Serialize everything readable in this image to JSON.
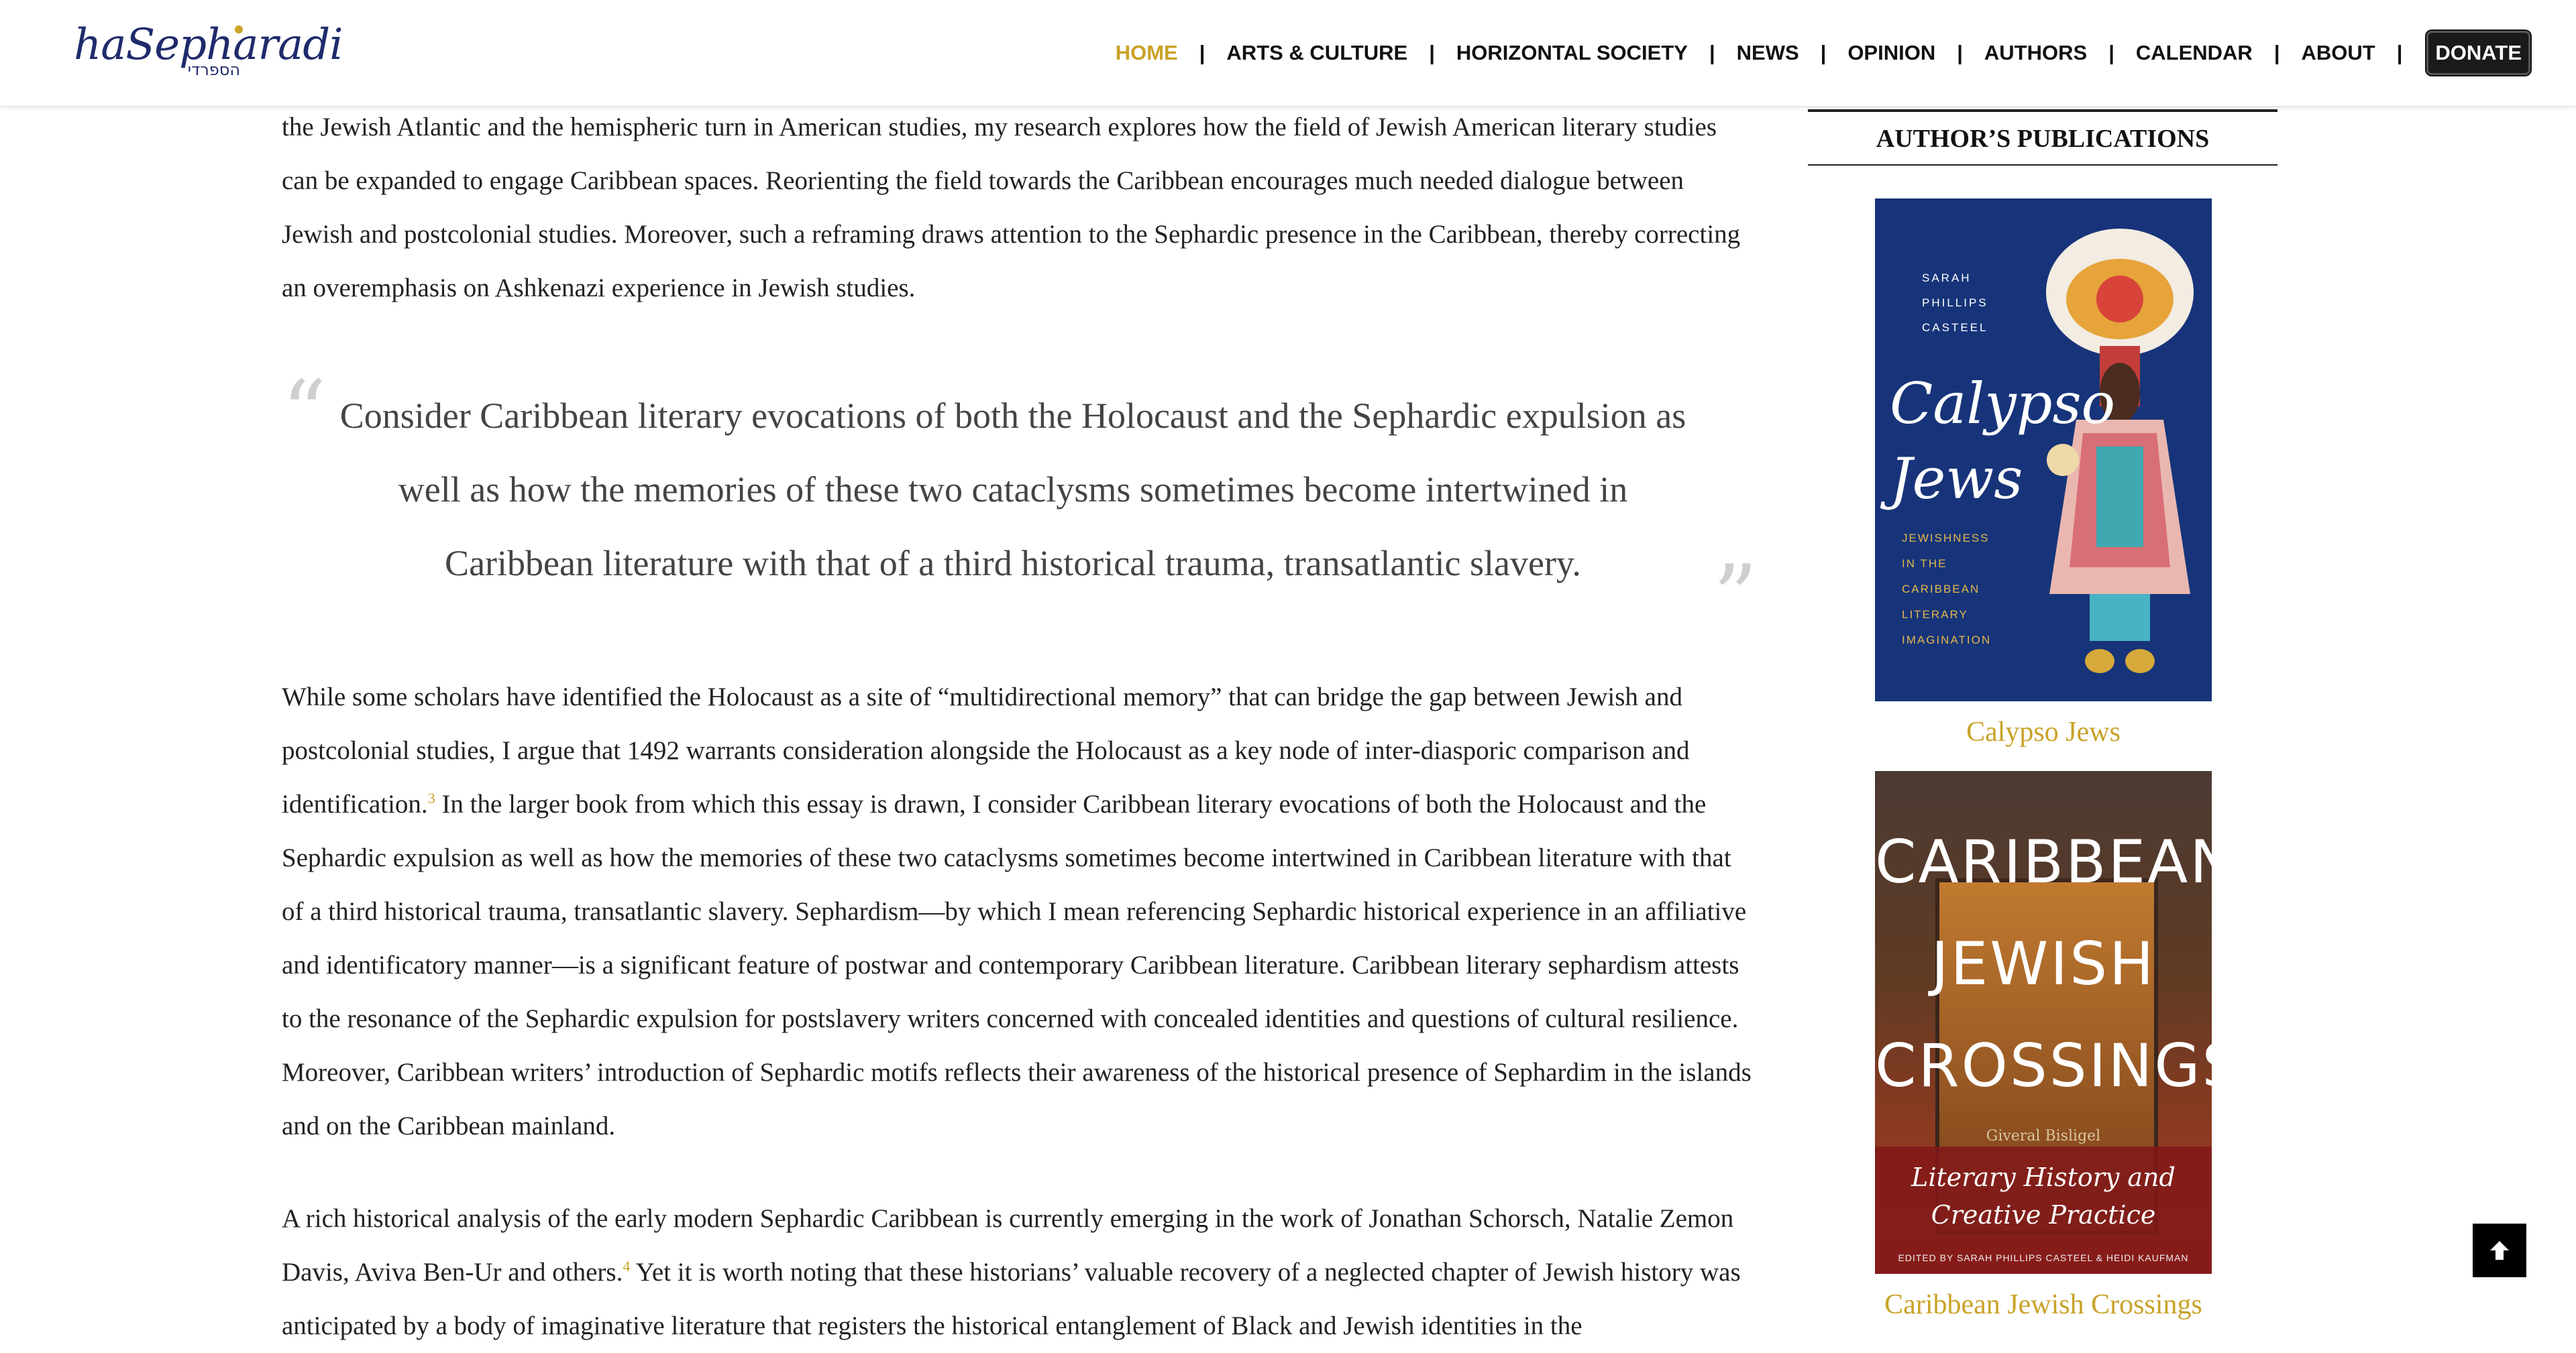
{
  "header": {
    "logo_text": "haSepharadi",
    "logo_hebrew": "הספרדי",
    "nav": [
      {
        "label": "HOME",
        "active": true
      },
      {
        "label": "ARTS & CULTURE",
        "active": false
      },
      {
        "label": "HORIZONTAL SOCIETY",
        "active": false
      },
      {
        "label": "NEWS",
        "active": false
      },
      {
        "label": "OPINION",
        "active": false
      },
      {
        "label": "AUTHORS",
        "active": false
      },
      {
        "label": "CALENDAR",
        "active": false
      },
      {
        "label": "ABOUT",
        "active": false
      }
    ],
    "separator": "|",
    "donate_label": "DONATE"
  },
  "article": {
    "intro_paragraph": "the Jewish Atlantic and the hemispheric turn in American studies, my research explores how the field of Jewish American literary studies can be expanded to engage Caribbean spaces. Reorienting the field towards the Caribbean encourages much needed dialogue between Jewish and postcolonial studies. Moreover, such a reframing draws attention to the Sephardic presence in the Caribbean, thereby correcting an overemphasis on Ashkenazi experience in Jewish studies.",
    "pull_quote": "Consider Caribbean literary evocations of both the Holocaust and the Sephardic expulsion as well as how the memories of these two cataclysms sometimes become intertwined in Caribbean literature with that of a third historical trauma, transatlantic slavery.",
    "paragraph2_a": "While some scholars have identified the Holocaust as a site of “multidirectional memory” that can bridge the gap between Jewish and postcolonial studies, I argue that 1492 warrants consideration alongside the Holocaust as a key node of inter-diasporic comparison and identification.",
    "footnote3": "3",
    "paragraph2_b": " In the larger book from which this essay is drawn, I consider Caribbean literary evocations of both the Holocaust and the Sephardic expulsion as well as how the memories of these two cataclysms sometimes become intertwined in Caribbean literature with that of a third historical trauma, transatlantic slavery. Sephardism—by which I mean referencing Sephardic historical experience in an affiliative and identificatory manner—is a significant feature of postwar and contemporary Caribbean literature. Caribbean literary sephardism attests to the resonance of the Sephardic expulsion for postslavery writers concerned with concealed identities and questions of cultural resilience. Moreover, Caribbean writers’ introduction of Sephardic motifs reflects their awareness of the historical presence of Sephardim in the islands and on the Caribbean mainland.",
    "paragraph3_a": "A rich historical analysis of the early modern Sephardic Caribbean is currently emerging in the work of Jonathan Schorsch, Natalie Zemon Davis, Aviva Ben-Ur and others.",
    "footnote4": "4",
    "paragraph3_b": " Yet it is worth noting that these historians’ valuable recovery of a neglected chapter of Jewish history was anticipated by a body of imaginative literature that registers the historical entanglement of Black and Jewish identities in the"
  },
  "sidebar": {
    "title": "AUTHOR’S PUBLICATIONS",
    "books": [
      {
        "caption": "Calypso Jews",
        "cover_author": [
          "SARAH",
          "PHILLIPS",
          "CASTEEL"
        ],
        "cover_title": [
          "Calypso",
          "Jews"
        ],
        "cover_subtitle": [
          "JEWISHNESS",
          "IN THE",
          "CARIBBEAN",
          "LITERARY",
          "IMAGINATION"
        ]
      },
      {
        "caption": "Caribbean Jewish Crossings",
        "cover_title": [
          "CARIBBEAN",
          "JEWISH",
          "CROSSINGS"
        ],
        "cover_subtitle": [
          "Literary History and",
          "Creative Practice"
        ],
        "cover_editors": "EDITED BY SARAH PHILLIPS CASTEEL & HEIDI KAUFMAN",
        "cover_small": "Giveral Bisligel"
      }
    ]
  },
  "colors": {
    "accent": "#c9a227",
    "text": "#222222",
    "cover1": "#17347a",
    "cover2": "#8a3a20"
  },
  "icons": {
    "back_to_top": "arrow-up-icon"
  }
}
